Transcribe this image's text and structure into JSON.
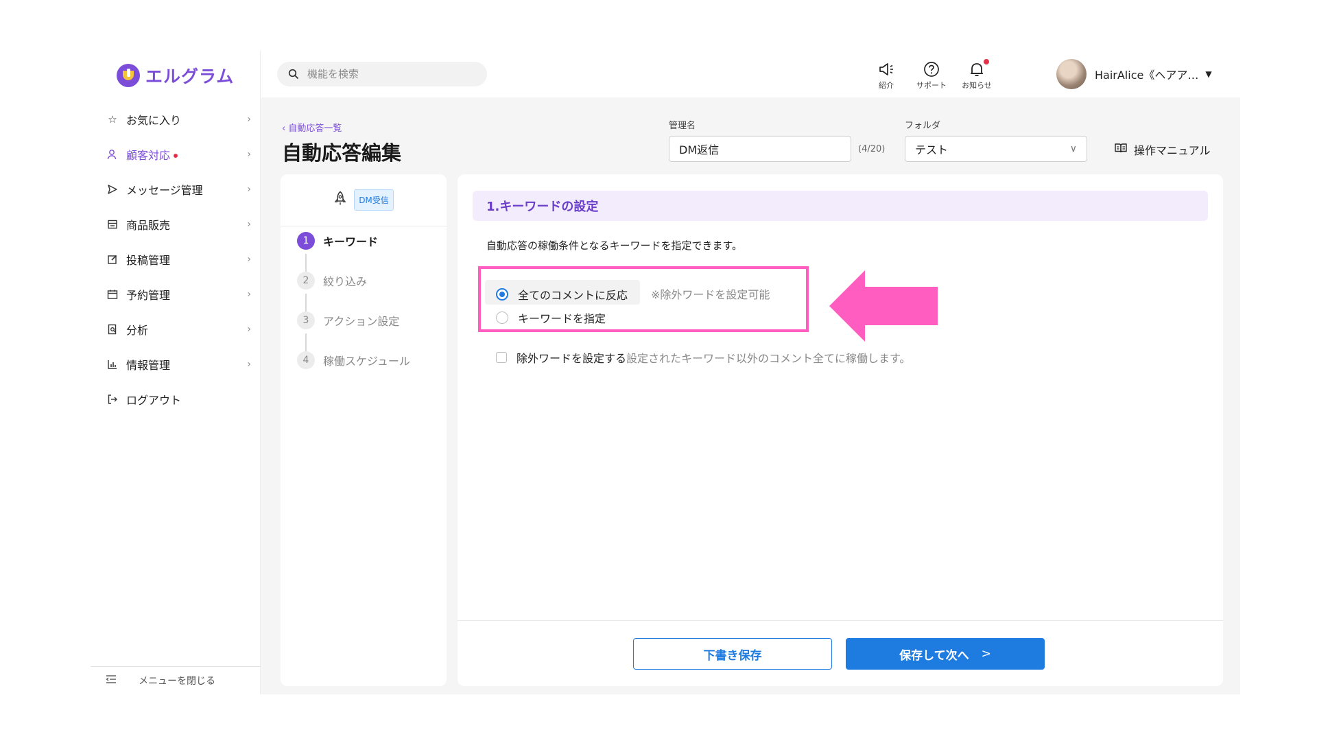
{
  "brand": {
    "name": "エルグラム",
    "color": "#7c4dd9"
  },
  "sidebar": {
    "items": [
      {
        "label": "お気に入り",
        "icon": "star-icon"
      },
      {
        "label": "顧客対応",
        "icon": "person-icon",
        "active": true,
        "badge": "red-dot"
      },
      {
        "label": "メッセージ管理",
        "icon": "send-icon"
      },
      {
        "label": "商品販売",
        "icon": "store-icon"
      },
      {
        "label": "投稿管理",
        "icon": "edit-icon"
      },
      {
        "label": "予約管理",
        "icon": "calendar-icon"
      },
      {
        "label": "分析",
        "icon": "report-icon"
      },
      {
        "label": "情報管理",
        "icon": "bar-chart-icon"
      },
      {
        "label": "ログアウト",
        "icon": "logout-icon"
      }
    ],
    "close_menu_label": "メニューを閉じる"
  },
  "header": {
    "search_placeholder": "機能を検索",
    "icons": [
      {
        "label": "紹介",
        "icon": "megaphone-icon"
      },
      {
        "label": "サポート",
        "icon": "help-icon"
      },
      {
        "label": "お知らせ",
        "icon": "bell-icon",
        "has_notification": true
      }
    ],
    "user_name": "HairAlice《ヘアア…"
  },
  "page": {
    "back_link": "自動応答一覧",
    "title": "自動応答編集",
    "name_label": "管理名",
    "name_value": "DM返信",
    "name_counter": "(4/20)",
    "folder_label": "フォルダ",
    "folder_value": "テスト",
    "manual_label": "操作マニュアル"
  },
  "steps": {
    "trigger_badge": "DM受信",
    "items": [
      {
        "num": "1",
        "label": "キーワード",
        "active": true
      },
      {
        "num": "2",
        "label": "絞り込み"
      },
      {
        "num": "3",
        "label": "アクション設定"
      },
      {
        "num": "4",
        "label": "稼働スケジュール"
      }
    ]
  },
  "content": {
    "section_title": "1.キーワードの設定",
    "description": "自動応答の稼働条件となるキーワードを指定できます。",
    "options": [
      {
        "label": "全てのコメントに反応",
        "selected": true,
        "note": "※除外ワードを設定可能"
      },
      {
        "label": "キーワードを指定",
        "selected": false
      }
    ],
    "exclude_checkbox_label": "除外ワードを設定する",
    "exclude_note": "設定されたキーワード以外のコメント全てに稼働します。",
    "draft_button": "下書き保存",
    "next_button": "保存して次へ",
    "next_arrow": ">"
  },
  "colors": {
    "accent_purple": "#7c4dd9",
    "primary_blue": "#1e7be0",
    "highlight_pink": "#ff5dbf",
    "notification_red": "#e5324a"
  }
}
